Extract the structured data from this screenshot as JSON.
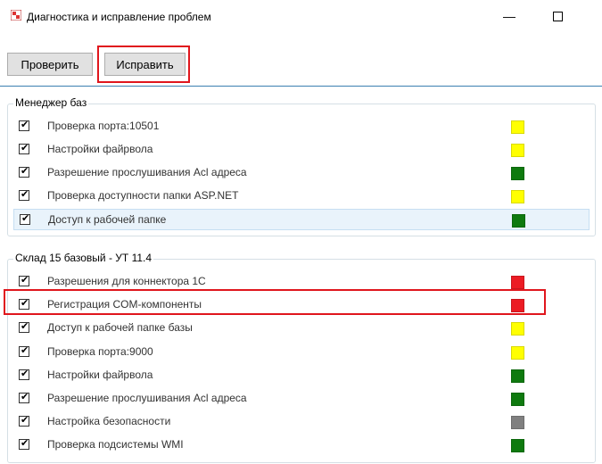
{
  "window": {
    "title": "Диагностика и исправление проблем",
    "minimize_glyph": "—",
    "close_glyph": "›"
  },
  "toolbar": {
    "check_label": "Проверить",
    "fix_label": "Исправить"
  },
  "colors": {
    "yellow": "#ffff00",
    "green": "#0f7a0f",
    "red": "#ec1c24",
    "gray": "#808080",
    "highlight": "#e0161d"
  },
  "groups": [
    {
      "label": "Менеджер баз",
      "items": [
        {
          "label": "Проверка порта:10501",
          "checked": true,
          "status": "yellow"
        },
        {
          "label": "Настройки файрвола",
          "checked": true,
          "status": "yellow"
        },
        {
          "label": "Разрешение прослушивания Acl адреса",
          "checked": true,
          "status": "green"
        },
        {
          "label": "Проверка доступности папки ASP.NET",
          "checked": true,
          "status": "yellow"
        },
        {
          "label": "Доступ к рабочей папке",
          "checked": true,
          "status": "green",
          "selected": true
        }
      ]
    },
    {
      "label": "Склад 15 базовый - УТ 11.4",
      "items": [
        {
          "label": "Разрешения для коннектора 1С",
          "checked": true,
          "status": "red"
        },
        {
          "label": "Регистрация COM-компоненты",
          "checked": true,
          "status": "red"
        },
        {
          "label": "Доступ к рабочей папке базы",
          "checked": true,
          "status": "yellow"
        },
        {
          "label": "Проверка порта:9000",
          "checked": true,
          "status": "yellow"
        },
        {
          "label": "Настройки файрвола",
          "checked": true,
          "status": "green"
        },
        {
          "label": "Разрешение прослушивания Acl адреса",
          "checked": true,
          "status": "green"
        },
        {
          "label": "Настройка безопасности",
          "checked": true,
          "status": "gray"
        },
        {
          "label": "Проверка подсистемы WMI",
          "checked": true,
          "status": "green"
        }
      ]
    }
  ]
}
